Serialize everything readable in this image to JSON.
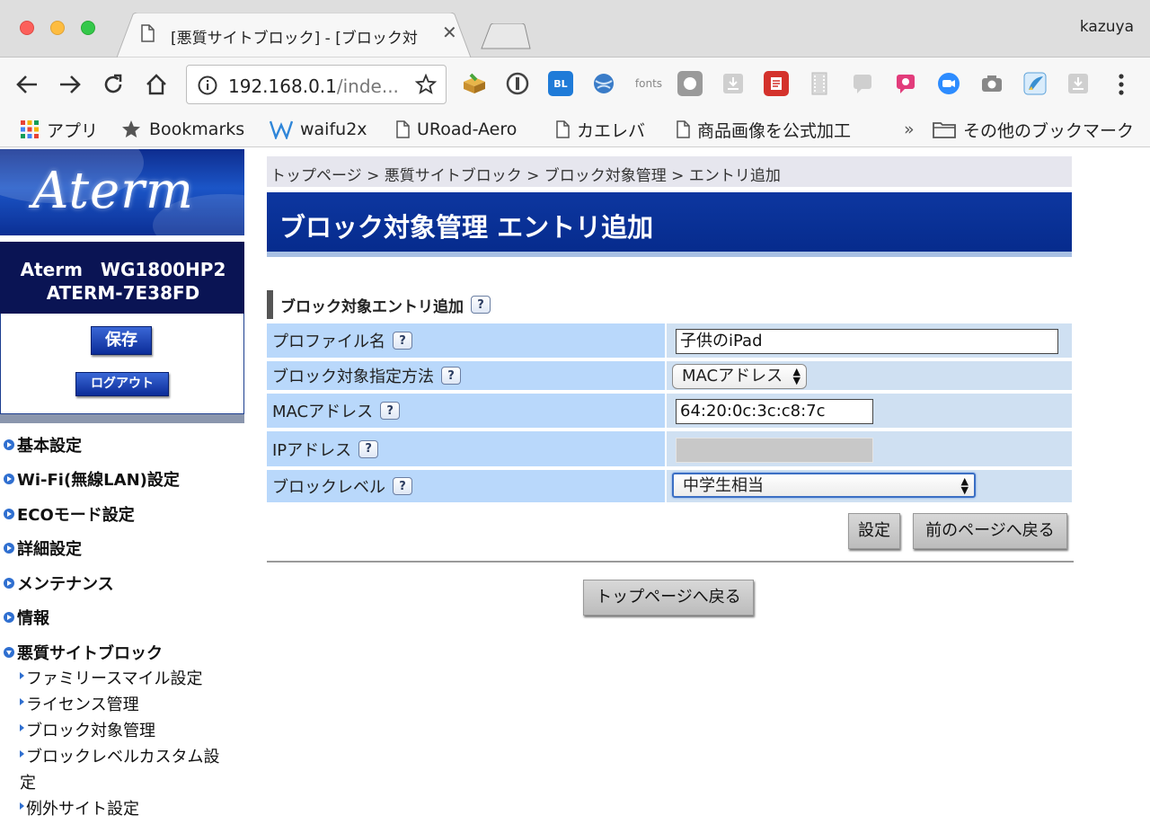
{
  "browser": {
    "tab_title": "[悪質サイトブロック] - [ブロック対",
    "profile_name": "kazuya",
    "url_host": "192.168.0.1",
    "url_path": "/inde...",
    "ext_fonts_label": "fonts"
  },
  "bookmarks": {
    "apps": "アプリ",
    "items": [
      "Bookmarks",
      "waifu2x",
      "URoad-Aero",
      "カエレバ",
      "商品画像を公式加工"
    ],
    "overflow": "»",
    "other": "その他のブックマーク"
  },
  "sidebar": {
    "logo": "Aterm",
    "model_line1": "Aterm　WG1800HP2",
    "model_line2": "ATERM-7E38FD",
    "save_label": "保存",
    "logout_label": "ログアウト",
    "menu": [
      "基本設定",
      "Wi-Fi(無線LAN)設定",
      "ECOモード設定",
      "詳細設定",
      "メンテナンス",
      "情報",
      "悪質サイトブロック"
    ],
    "submenu": [
      "ファミリースマイル設定",
      "ライセンス管理",
      "ブロック対象管理",
      "ブロックレベルカスタム設",
      "定",
      "例外サイト設定"
    ]
  },
  "main": {
    "breadcrumb": "トップページ > 悪質サイトブロック > ブロック対象管理 > エントリ追加",
    "page_title": "ブロック対象管理 エントリ追加",
    "section_title": "ブロック対象エントリ追加",
    "help_glyph": "?",
    "fields": {
      "profile_label": "プロファイル名",
      "profile_value": "子供のiPad",
      "method_label": "ブロック対象指定方法",
      "method_value": "MACアドレス",
      "mac_label": "MACアドレス",
      "mac_value": "64:20:0c:3c:c8:7c",
      "ip_label": "IPアドレス",
      "level_label": "ブロックレベル",
      "level_value": "中学生相当"
    },
    "set_button": "設定",
    "back_button": "前のページへ戻る",
    "top_button": "トップページへ戻る"
  }
}
